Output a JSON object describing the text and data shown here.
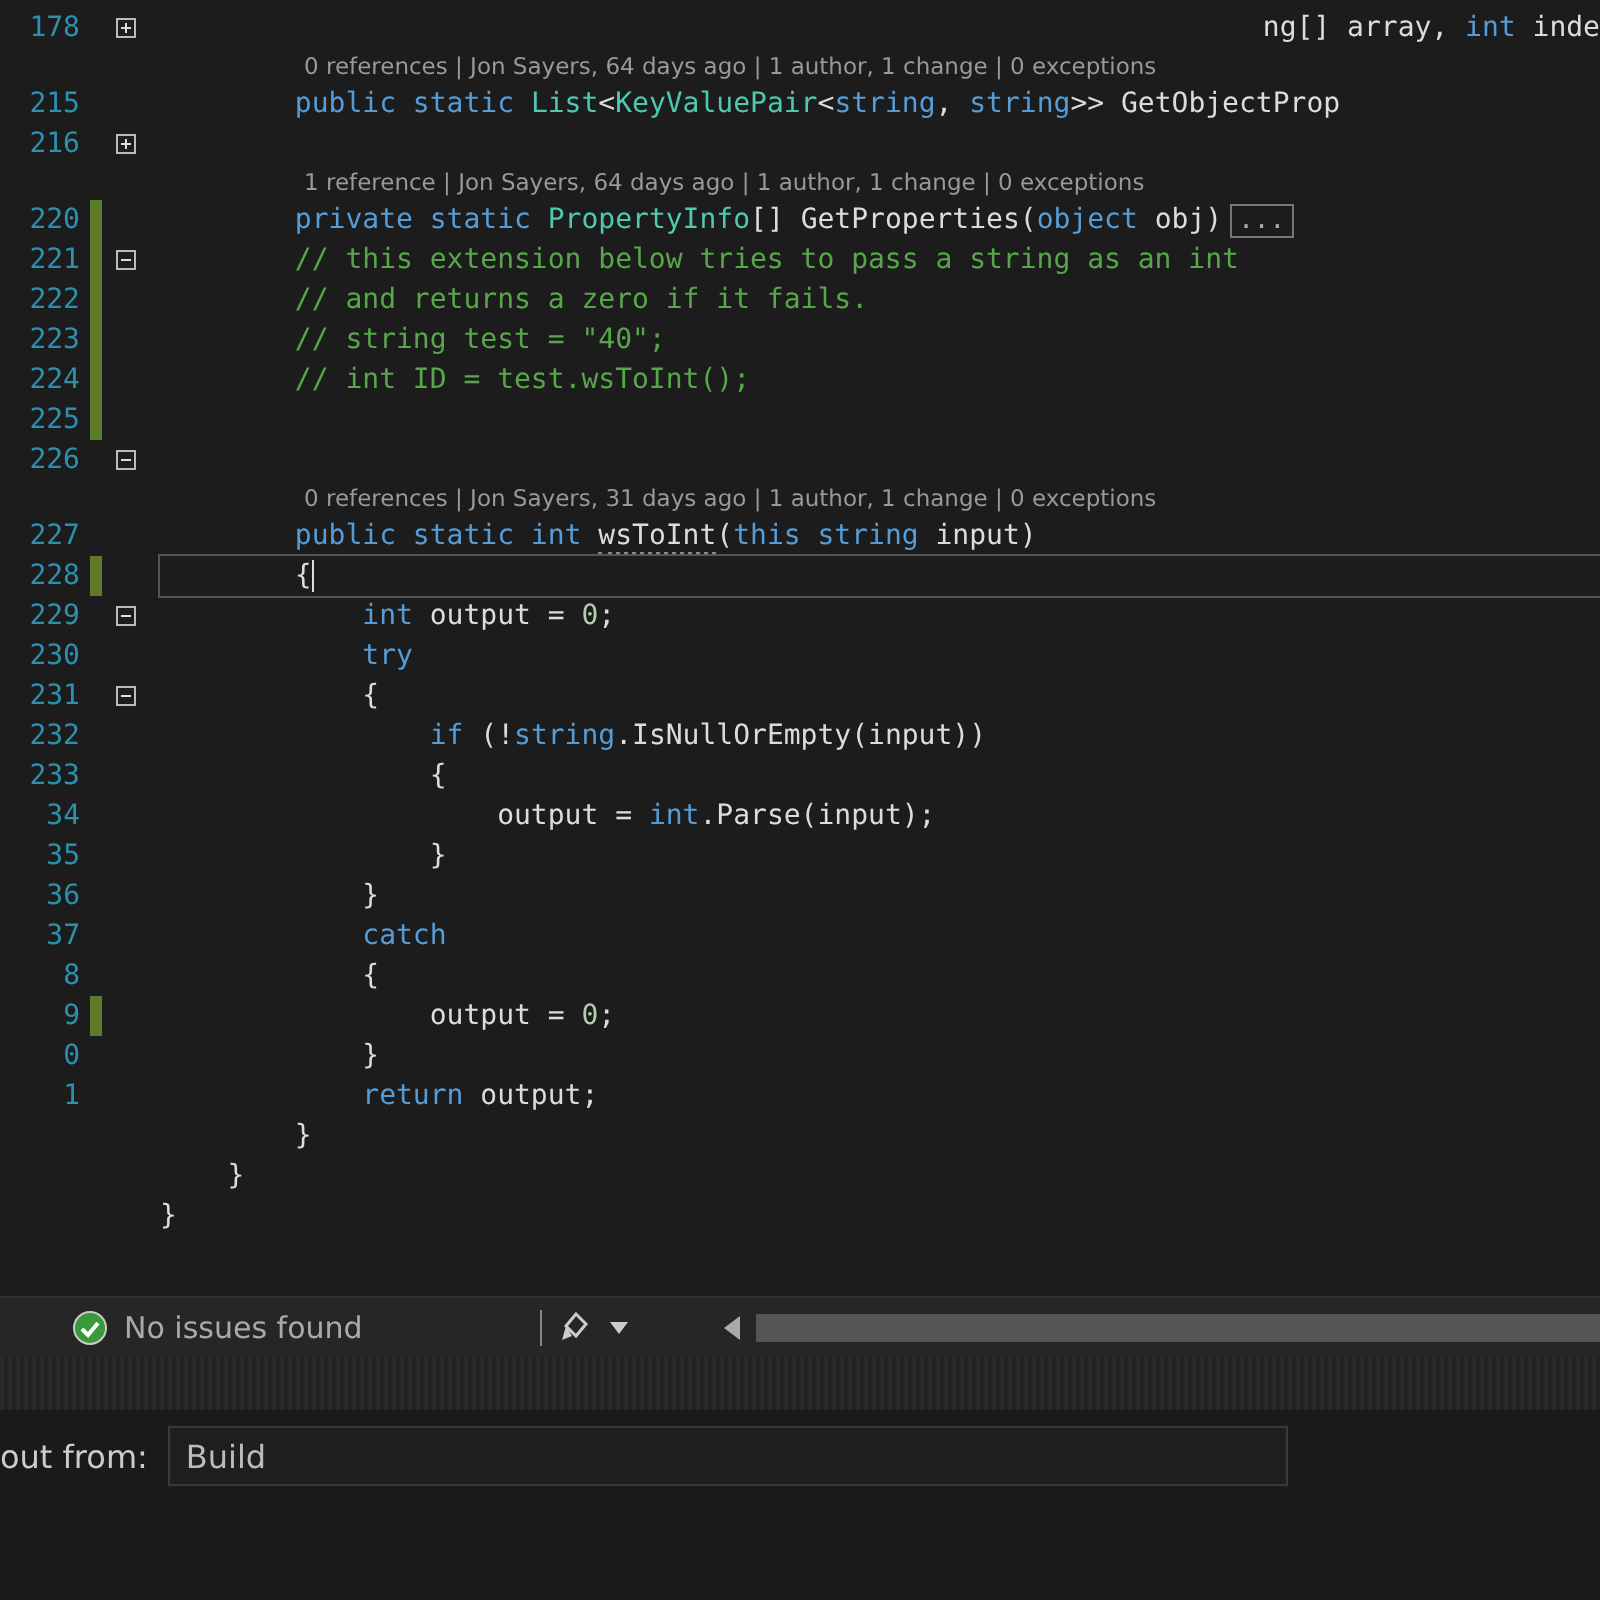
{
  "editor": {
    "lines": [
      {
        "kind": "code",
        "number": "178",
        "changed": false,
        "fold_expanded": false,
        "clipped_start": true,
        "tokens": [
          {
            "kind": "plain",
            "text": "ng[] array, "
          },
          {
            "kind": "keyword",
            "text": "int"
          },
          {
            "kind": "plain",
            "text": " inde"
          }
        ]
      },
      {
        "kind": "lens",
        "text": "0 references | Jon Sayers, 64 days ago | 1 author, 1 change | 0 exceptions"
      },
      {
        "kind": "code",
        "number": "215",
        "changed": false,
        "tokens": [
          {
            "kind": "keyword",
            "text": "        public static "
          },
          {
            "kind": "type",
            "text": "List"
          },
          {
            "kind": "plain",
            "text": "<"
          },
          {
            "kind": "type",
            "text": "KeyValuePair"
          },
          {
            "kind": "plain",
            "text": "<"
          },
          {
            "kind": "keyword",
            "text": "string"
          },
          {
            "kind": "plain",
            "text": ", "
          },
          {
            "kind": "keyword",
            "text": "string"
          },
          {
            "kind": "plain",
            "text": ">> GetObjectProp"
          }
        ]
      },
      {
        "kind": "code",
        "number": "216",
        "changed": false,
        "fold_expanded": false
      },
      {
        "kind": "lens",
        "text": "1 reference | Jon Sayers, 64 days ago | 1 author, 1 change | 0 exceptions"
      },
      {
        "kind": "code",
        "number": "220",
        "changed": true,
        "collapsed": "...",
        "tokens": [
          {
            "kind": "keyword",
            "text": "        private static "
          },
          {
            "kind": "type",
            "text": "PropertyInfo"
          },
          {
            "kind": "plain",
            "text": "[] GetProperties("
          },
          {
            "kind": "keyword",
            "text": "object"
          },
          {
            "kind": "plain",
            "text": " obj)"
          }
        ]
      },
      {
        "kind": "code",
        "number": "221",
        "changed": true,
        "fold_expanded": true,
        "tokens": [
          {
            "kind": "comment",
            "text": "        // this extension below tries to pass a string as an int"
          }
        ]
      },
      {
        "kind": "code",
        "number": "222",
        "changed": true,
        "tokens": [
          {
            "kind": "comment",
            "text": "        // and returns a zero if it fails."
          }
        ]
      },
      {
        "kind": "code",
        "number": "223",
        "changed": true,
        "tokens": [
          {
            "kind": "comment",
            "text": "        // string test = \"40\";"
          }
        ]
      },
      {
        "kind": "code",
        "number": "224",
        "changed": true,
        "tokens": [
          {
            "kind": "comment",
            "text": "        // int ID = test.wsToInt();"
          }
        ]
      },
      {
        "kind": "code",
        "number": "225",
        "changed": true
      },
      {
        "kind": "code",
        "number": "226",
        "changed": false,
        "fold_expanded": true
      },
      {
        "kind": "lens",
        "text": "0 references | Jon Sayers, 31 days ago | 1 author, 1 change | 0 exceptions"
      },
      {
        "kind": "code",
        "number": "227",
        "changed": false,
        "tokens": [
          {
            "kind": "keyword",
            "text": "        public static int "
          },
          {
            "kind": "hint",
            "text": "wsToInt"
          },
          {
            "kind": "plain",
            "text": "("
          },
          {
            "kind": "keyword",
            "text": "this string"
          },
          {
            "kind": "plain",
            "text": " input)"
          }
        ]
      },
      {
        "kind": "code",
        "number": "228",
        "changed": true,
        "current": true,
        "tokens": [
          {
            "kind": "plain",
            "text": "        {"
          }
        ]
      },
      {
        "kind": "code",
        "number": "229",
        "changed": false,
        "fold_expanded": true,
        "tokens": [
          {
            "kind": "keyword",
            "text": "            int"
          },
          {
            "kind": "plain",
            "text": " output = "
          },
          {
            "kind": "number",
            "text": "0"
          },
          {
            "kind": "plain",
            "text": ";"
          }
        ]
      },
      {
        "kind": "code",
        "number": "230",
        "changed": false,
        "tokens": [
          {
            "kind": "keyword",
            "text": "            try"
          }
        ]
      },
      {
        "kind": "code",
        "number": "231",
        "changed": false,
        "fold_expanded": true,
        "tokens": [
          {
            "kind": "plain",
            "text": "            {"
          }
        ]
      },
      {
        "kind": "code",
        "number": "232",
        "changed": false,
        "tokens": [
          {
            "kind": "keyword",
            "text": "                if"
          },
          {
            "kind": "plain",
            "text": " (!"
          },
          {
            "kind": "keyword",
            "text": "string"
          },
          {
            "kind": "plain",
            "text": ".IsNullOrEmpty(input))"
          }
        ]
      },
      {
        "kind": "code",
        "number": "233",
        "changed": false,
        "tokens": [
          {
            "kind": "plain",
            "text": "                {"
          }
        ]
      },
      {
        "kind": "code",
        "number": "34",
        "changed": false,
        "tokens": [
          {
            "kind": "plain",
            "text": "                    output = "
          },
          {
            "kind": "keyword",
            "text": "int"
          },
          {
            "kind": "plain",
            "text": ".Parse(input);"
          }
        ]
      },
      {
        "kind": "code",
        "number": "35",
        "changed": false,
        "tokens": [
          {
            "kind": "plain",
            "text": "                }"
          }
        ]
      },
      {
        "kind": "code",
        "number": "36",
        "changed": false,
        "tokens": [
          {
            "kind": "plain",
            "text": "            }"
          }
        ]
      },
      {
        "kind": "code",
        "number": "37",
        "changed": false,
        "tokens": [
          {
            "kind": "keyword",
            "text": "            catch"
          }
        ]
      },
      {
        "kind": "code",
        "number": "8",
        "changed": false,
        "tokens": [
          {
            "kind": "plain",
            "text": "            {"
          }
        ]
      },
      {
        "kind": "code",
        "number": "9",
        "changed": true,
        "tokens": [
          {
            "kind": "plain",
            "text": "                output = "
          },
          {
            "kind": "number",
            "text": "0"
          },
          {
            "kind": "plain",
            "text": ";"
          }
        ]
      },
      {
        "kind": "code",
        "number": "0",
        "changed": false,
        "tokens": [
          {
            "kind": "plain",
            "text": "            }"
          }
        ]
      },
      {
        "kind": "code",
        "number": "1",
        "changed": false,
        "tokens": [
          {
            "kind": "keyword",
            "text": "            return"
          },
          {
            "kind": "plain",
            "text": " output;"
          }
        ]
      },
      {
        "kind": "code",
        "changed": false,
        "tokens": [
          {
            "kind": "plain",
            "text": "        }"
          }
        ]
      },
      {
        "kind": "code",
        "changed": false,
        "tokens": [
          {
            "kind": "plain",
            "text": "    }"
          }
        ]
      },
      {
        "kind": "code",
        "changed": false,
        "tokens": [
          {
            "kind": "plain",
            "text": "}"
          }
        ]
      }
    ]
  },
  "status_bar": {
    "issues": "No issues found"
  },
  "output_panel": {
    "label": "out from:",
    "source": "Build"
  }
}
